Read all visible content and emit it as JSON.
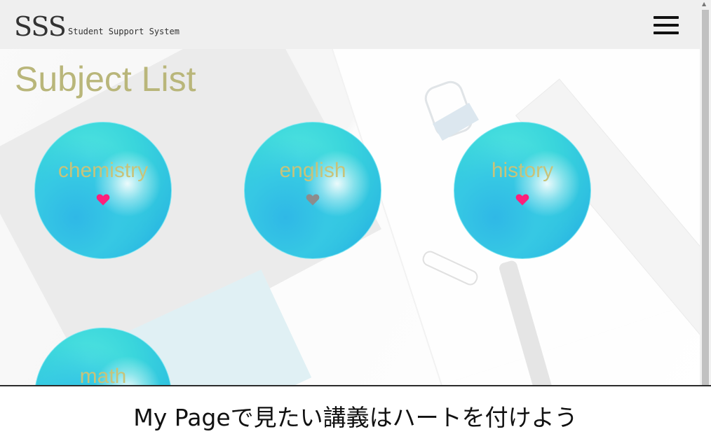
{
  "header": {
    "logo_main": "SSS",
    "logo_sub": "Student Support System",
    "menu_icon": "hamburger-menu-icon"
  },
  "page": {
    "title": "Subject List"
  },
  "subjects": [
    {
      "label": "chemistry",
      "favorited": true,
      "heart_color": "#ff1f7a"
    },
    {
      "label": "english",
      "favorited": false,
      "heart_color": "#8c8c8c"
    },
    {
      "label": "history",
      "favorited": true,
      "heart_color": "#ff1f7a"
    },
    {
      "label": "math"
    }
  ],
  "caption": "My Pageで見たい講義はハートを付けよう",
  "colors": {
    "title": "#b9b67a",
    "subject_label": "#c8c37a",
    "heart_active": "#ff1f7a",
    "heart_inactive": "#8c8c8c",
    "circle": "#3ad6dc"
  }
}
